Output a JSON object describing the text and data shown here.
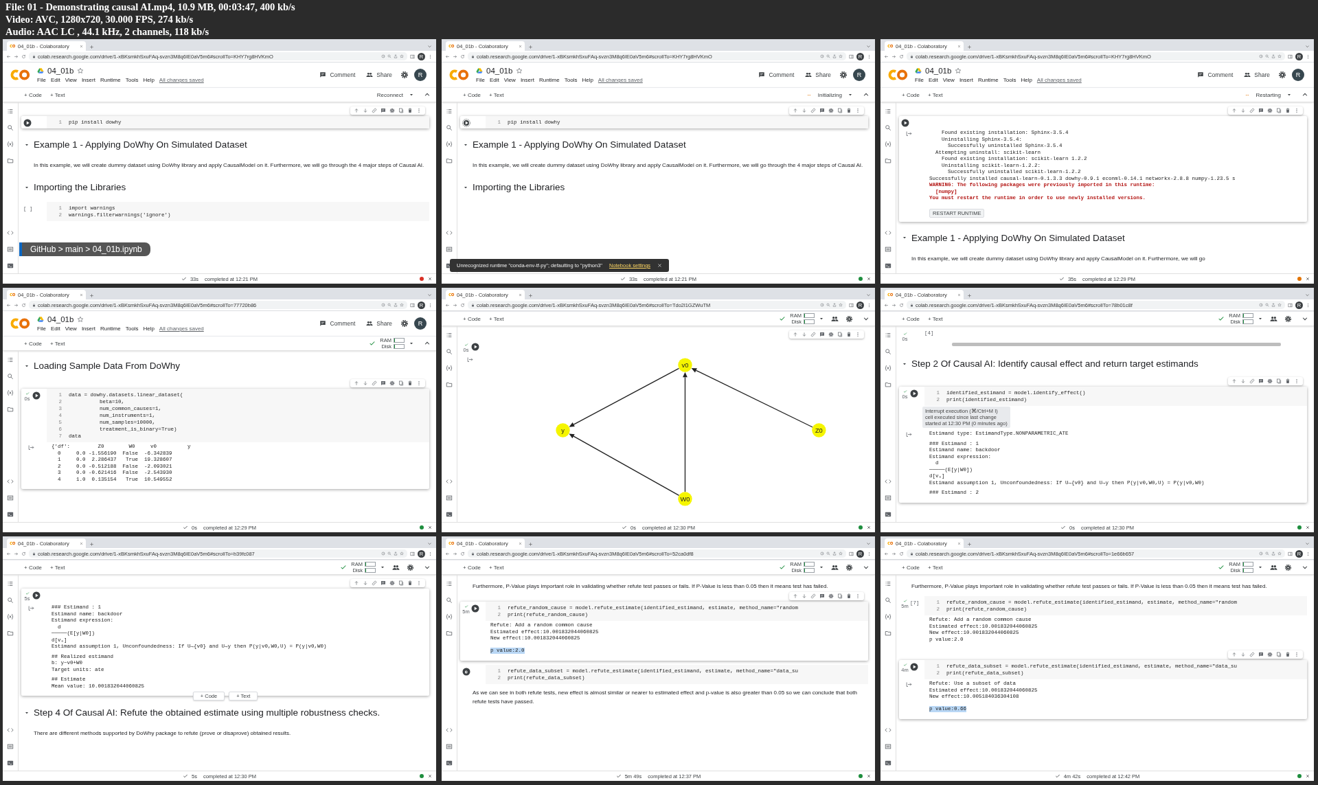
{
  "video_info": [
    "File: 01 - Demonstrating causal AI.mp4, 10.9 MB, 00:03:47, 400 kb/s",
    "Video: AVC, 1280x720, 30.000 FPS, 274 kb/s",
    "Audio: AAC LC , 44.1 kHz, 2 channels, 118 kb/s"
  ],
  "tiles": [
    {
      "browser": {
        "tab_title": "04_01b - Colaboratory",
        "url": "colab.research.google.com/drive/1-xBKsmkhSxuFAq-svzn3M8q6IE0aV5m6#scrollTo=KHY7rg8HVKmO",
        "profile": "R"
      },
      "notebook": {
        "name": "04_01b",
        "menu": [
          "File",
          "Edit",
          "View",
          "Insert",
          "Runtime",
          "Tools",
          "Help"
        ],
        "saved": "All changes saved",
        "comment": "Comment",
        "share": "Share",
        "avatar": "R"
      },
      "toolbar": {
        "add": [
          "+ Code",
          "+ Text"
        ],
        "runtime": {
          "kind": "button",
          "label": "Reconnect"
        }
      },
      "blocks": [
        {
          "kind": "code",
          "running": false,
          "pending": false,
          "focused": true,
          "toolbar": true,
          "lines": [
            [
              "1",
              "pip install dowhy"
            ]
          ]
        },
        {
          "kind": "heading",
          "text": "Example 1 - Applying DoWhy On Simulated Dataset"
        },
        {
          "kind": "text",
          "text": "In this example, we will create dummy dataset using DoWhy library and apply CausalModel on it. Furthermore, we will go through the 4 major steps of Causal AI."
        },
        {
          "kind": "heading",
          "text": "Importing the Libraries"
        },
        {
          "kind": "code",
          "prompt": "[ ]",
          "focused": false,
          "lines": [
            [
              "1",
              "import warnings"
            ],
            [
              "2",
              "warnings.filterwarnings('ignore')"
            ]
          ]
        }
      ],
      "overlay": {
        "kind": "banner",
        "text": "GitHub > main > 04_01b.ipynb"
      },
      "status": {
        "duration": "33s",
        "completed": "completed at 12:21 PM",
        "color": "#d93025"
      }
    },
    {
      "browser": {
        "tab_title": "04_01b - Colaboratory",
        "url": "colab.research.google.com/drive/1-xBKsmkhSxuFAq-svzn3M8q6IE0aV5m6#scrollTo=KHY7rg8HVKmO",
        "profile": "R"
      },
      "notebook": {
        "name": "04_01b",
        "menu": [
          "File",
          "Edit",
          "View",
          "Insert",
          "Runtime",
          "Tools",
          "Help"
        ],
        "saved": "All changes saved",
        "comment": "Comment",
        "share": "Share",
        "avatar": "R"
      },
      "toolbar": {
        "add": [
          "+ Code",
          "+ Text"
        ],
        "runtime": {
          "kind": "busy",
          "label": "Initializing"
        }
      },
      "blocks": [
        {
          "kind": "code",
          "running": true,
          "pending": false,
          "focused": true,
          "toolbar": true,
          "lines": [
            [
              "1",
              "pip install dowhy"
            ]
          ]
        },
        {
          "kind": "heading",
          "text": "Example 1 - Applying DoWhy On Simulated Dataset"
        },
        {
          "kind": "text",
          "text": "In this example, we will create dummy dataset using DoWhy library and apply CausalModel on it. Furthermore, we will go through the 4 major steps of Causal AI."
        },
        {
          "kind": "heading",
          "text": "Importing the Libraries"
        }
      ],
      "overlay": {
        "kind": "toast",
        "text": "Unrecognized runtime \"conda-env-tf-py\"; defaulting to \"python3\"",
        "link": "Notebook settings"
      },
      "status": {
        "duration": "33s",
        "completed": "completed at 12:21 PM",
        "color": "#1e8e3e"
      }
    },
    {
      "browser": {
        "tab_title": "04_01b - Colaboratory",
        "url": "colab.research.google.com/drive/1-xBKsmkhSxuFAq-svzn3M8q6IE0aV5m6#scrollTo=KHY7rg8HVKmO",
        "profile": "R"
      },
      "notebook": {
        "name": "04_01b",
        "menu": [
          "File",
          "Edit",
          "View",
          "Insert",
          "Runtime",
          "Tools",
          "Help"
        ],
        "saved": "All changes saved",
        "comment": "Comment",
        "share": "Share",
        "avatar": "R"
      },
      "toolbar": {
        "add": [
          "+ Code",
          "+ Text"
        ],
        "runtime": {
          "kind": "busy",
          "label": "Restarting"
        }
      },
      "blocks": [
        {
          "kind": "code",
          "running": false,
          "pending": false,
          "focused": true,
          "toolbar": true,
          "output": {
            "icon": true,
            "groups": [
              [
                "    Found existing installation: Sphinx-3.5.4",
                "    Uninstalling Sphinx-3.5.4:",
                "      Successfully uninstalled Sphinx-3.5.4",
                "  Attempting uninstall: scikit-learn",
                "    Found existing installation: scikit-learn 1.2.2",
                "    Uninstalling scikit-learn-1.2.2:",
                "      Successfully uninstalled scikit-learn-1.2.2",
                "Successfully installed causal-learn-0.1.3.3 dowhy-0.9.1 econml-0.14.1 networkx-2.8.8 numpy-1.23.5 s",
                {
                  "text": "WARNING: The following packages were previously imported in this runtime:",
                  "kind": "warning"
                },
                {
                  "text": "  [numpy]",
                  "kind": "warning"
                },
                {
                  "text": "You must restart the runtime in order to use newly installed versions.",
                  "kind": "warning"
                }
              ]
            ],
            "button": "RESTART RUNTIME"
          }
        },
        {
          "kind": "heading",
          "text": "Example 1 - Applying DoWhy On Simulated Dataset"
        },
        {
          "kind": "text",
          "text": "In this example, we will create dummy dataset using DoWhy library and apply CausalModel on it. Furthermore, we will go"
        }
      ],
      "status": {
        "duration": "35s",
        "completed": "completed at 12:29 PM",
        "color": "#e37400"
      }
    },
    {
      "browser": {
        "tab_title": "04_01b - Colaboratory",
        "url": "colab.research.google.com/drive/1-xBKsmkhSxuFAq-svzn3M8q6IE0aV5m6#scrollTo=77720b86",
        "profile": "R"
      },
      "notebook": {
        "name": "04_01b",
        "menu": [
          "File",
          "Edit",
          "View",
          "Insert",
          "Runtime",
          "Tools",
          "Help"
        ],
        "saved": "All changes saved",
        "comment": "Comment",
        "share": "Share",
        "avatar": "R"
      },
      "toolbar": {
        "add": [
          "+ Code",
          "+ Text"
        ],
        "runtime": {
          "kind": "resources",
          "meters": [
            {
              "label": "RAM",
              "level": 0.05
            },
            {
              "label": "Disk",
              "level": 0.05
            }
          ]
        }
      },
      "blocks": [
        {
          "kind": "heading",
          "text": "Loading Sample Data From DoWhy"
        },
        {
          "kind": "code",
          "running": false,
          "pending": false,
          "exec": "0s",
          "focused": true,
          "toolbar": true,
          "lines": [
            [
              "1",
              "data = dowhy.datasets.linear_dataset("
            ],
            [
              "2",
              "          beta=10,"
            ],
            [
              "3",
              "          num_common_causes=1,"
            ],
            [
              "4",
              "          num_instruments=1,"
            ],
            [
              "5",
              "          num_samples=10000,"
            ],
            [
              "6",
              "          treatment_is_binary=True)"
            ],
            [
              "7",
              "data"
            ]
          ],
          "output": {
            "icon": true,
            "groups": [
              [
                "{'df':         Z0        W0     v0          y",
                "  0     0.0 -1.556190  False  -6.342839",
                "  1     0.0  2.286437   True  19.328607",
                "  2     0.0 -0.512188  False  -2.093021",
                "  3     0.0 -0.621416  False  -2.543930",
                "  4     1.0  0.135154   True  10.549552"
              ]
            ]
          }
        }
      ],
      "status": {
        "duration": "0s",
        "completed": "completed at 12:29 PM",
        "color": "#1e8e3e"
      }
    },
    {
      "browser": {
        "tab_title": "04_01b - Colaboratory",
        "url": "colab.research.google.com/drive/1-xBKsmkhSxuFAq-svzn3M8q6IE0aV5m6#scrollTo=Tdo2l1GZWuTM",
        "profile": "R"
      },
      "toolbar": {
        "add": [
          "+ Code",
          "+ Text"
        ],
        "runtime": {
          "kind": "resources",
          "meters": [
            {
              "label": "RAM",
              "level": 0.05
            },
            {
              "label": "Disk",
              "level": 0.05
            }
          ]
        }
      },
      "blocks": [
        {
          "kind": "code",
          "running": false,
          "pending": false,
          "exec": "0s",
          "focused": false,
          "toolbar": true,
          "output": {
            "icon": true,
            "graph": {
              "nodes": [
                {
                  "label": "v0"
                },
                {
                  "label": "y"
                },
                {
                  "label": "Z0"
                },
                {
                  "label": "W0"
                }
              ]
            }
          }
        }
      ],
      "status": {
        "duration": "0s",
        "completed": "completed at 12:30 PM",
        "color": "#1e8e3e"
      }
    },
    {
      "browser": {
        "tab_title": "04_01b - Colaboratory",
        "url": "colab.research.google.com/drive/1-xBKsmkhSxuFAq-svzn3M8q6IE0aV5m6#scrollTo=78b01c8f",
        "profile": "R"
      },
      "toolbar": {
        "add": [
          "+ Code",
          "+ Text"
        ],
        "runtime": {
          "kind": "resources",
          "meters": [
            {
              "label": "RAM",
              "level": 0.05
            },
            {
              "label": "Disk",
              "level": 0.05
            }
          ]
        }
      },
      "blocks": [
        {
          "kind": "cell_tail",
          "prompt": "[4]",
          "exec": "0s"
        },
        {
          "kind": "heading",
          "text": "Step 2 Of Causal AI: Identify causal effect and return target estimands"
        },
        {
          "kind": "code",
          "running": false,
          "pending": false,
          "exec": "0s",
          "focused": true,
          "toolbar": true,
          "lines": [
            [
              "1",
              "identified_estimand = model.identify_effect()"
            ],
            [
              "2",
              "print(identified_estimand)"
            ]
          ],
          "tooltip": [
            "Interrupt execution (⌘/Ctrl+M I)",
            "cell executed since last change",
            "started at 12:30 PM (0 minutes ago)"
          ],
          "output": {
            "icon": true,
            "groups": [
              [
                "Estimand type: EstimandType.NONPARAMETRIC_ATE"
              ],
              [
                "### Estimand : 1",
                "Estimand name: backdoor",
                "Estimand expression:",
                "  d",
                "─────(E[y|W0])",
                "d[v₀]",
                "Estimand assumption 1, Unconfoundedness: If U→{v0} and U→y then P(y|v0,W0,U) = P(y|v0,W0)"
              ],
              [
                "### Estimand : 2"
              ]
            ]
          }
        }
      ],
      "status": {
        "duration": "0s",
        "completed": "completed at 12:30 PM",
        "color": "#1e8e3e"
      }
    },
    {
      "browser": {
        "tab_title": "04_01b - Colaboratory",
        "url": "colab.research.google.com/drive/1-xBKsmkhSxuFAq-svzn3M8q6IE0aV5m6#scrollTo=b39fc087",
        "profile": "R"
      },
      "toolbar": {
        "add": [
          "+ Code",
          "+ Text"
        ],
        "runtime": {
          "kind": "resources",
          "meters": [
            {
              "label": "RAM",
              "level": 0.05
            },
            {
              "label": "Disk",
              "level": 0.05
            }
          ]
        }
      },
      "blocks": [
        {
          "kind": "code",
          "running": false,
          "pending": false,
          "exec": "5s",
          "focused": true,
          "toolbar": true,
          "output": {
            "icon": true,
            "groups": [
              [
                "### Estimand : 1",
                "Estimand name: backdoor",
                "Estimand expression:",
                "  d",
                "─────(E[y|W0])",
                "d[v₀]",
                "Estimand assumption 1, Unconfoundedness: If U→{v0} and U→y then P(y|v0,W0,U) = P(y|v0,W0)"
              ],
              [
                "## Realized estimand",
                "b: y~v0+W0",
                "Target units: ate"
              ],
              [
                "## Estimate",
                "Mean value: 10.001832044060825"
              ]
            ]
          }
        },
        {
          "kind": "add_cell",
          "buttons": [
            "+ Code",
            "+ Text"
          ]
        },
        {
          "kind": "heading",
          "text": "Step 4 Of Causal AI: Refute the obtained estimate using multiple robustness checks."
        },
        {
          "kind": "text",
          "text": "There are different methods supported by DoWhy package to refute (prove or disaprove) obtained results."
        }
      ],
      "status": {
        "duration": "5s",
        "completed": "completed at 12:30 PM",
        "color": "#1e8e3e"
      }
    },
    {
      "browser": {
        "tab_title": "04_01b - Colaboratory",
        "url": "colab.research.google.com/drive/1-xBKsmkhSxuFAq-svzn3M8q6IE0aV5m6#scrollTo=52ca0df8",
        "profile": "R"
      },
      "toolbar": {
        "add": [
          "+ Code",
          "+ Text"
        ],
        "runtime": {
          "kind": "resources",
          "meters": [
            {
              "label": "RAM",
              "level": 0.05
            },
            {
              "label": "Disk",
              "level": 0.05
            }
          ]
        }
      },
      "blocks": [
        {
          "kind": "text",
          "text": "Furthermore, P-Value plays important role in validating whether refute test passes or fails. If P-Value is less than 0.05 then it means test has failed."
        },
        {
          "kind": "code",
          "running": false,
          "pending": false,
          "exec": "5m",
          "focused": true,
          "toolbar": true,
          "lines": [
            [
              "1",
              "refute_random_cause = model.refute_estimate(identified_estimand, estimate, method_name=\"random"
            ],
            [
              "2",
              "print(refute_random_cause)"
            ]
          ],
          "output": {
            "groups": [
              [
                "Refute: Add a random common cause",
                "Estimated effect:10.001832044060825",
                "New effect:10.001832044060825",
                {
                  "text": "p value:2.0",
                  "kind": "highlight"
                }
              ]
            ]
          }
        },
        {
          "kind": "code",
          "running": false,
          "pending": true,
          "focused": false,
          "lines": [
            [
              "1",
              "refute_data_subset = model.refute_estimate(identified_estimand, estimate, method_name=\"data_su"
            ],
            [
              "2",
              "print(refute_data_subset)"
            ]
          ]
        },
        {
          "kind": "text",
          "text": "As we can see in both refute tests, new effect is almost similar or nearer to estimated effect and p-value is also greater than 0.05 so we can conclude that both refute tests have passed."
        }
      ],
      "status": {
        "duration": "5m 49s",
        "completed": "completed at 12:37 PM",
        "color": "#1e8e3e"
      }
    },
    {
      "browser": {
        "tab_title": "04_01b - Colaboratory",
        "url": "colab.research.google.com/drive/1-xBKsmkhSxuFAq-svzn3M8q6IE0aV5m6#scrollTo=1e66b657",
        "profile": "R"
      },
      "toolbar": {
        "add": [
          "+ Code",
          "+ Text"
        ],
        "runtime": {
          "kind": "resources",
          "meters": [
            {
              "label": "RAM",
              "level": 0.05
            },
            {
              "label": "Disk",
              "level": 0.05
            }
          ]
        }
      },
      "blocks": [
        {
          "kind": "text",
          "text": "Furthermore, P-Value plays important role in validating whether refute test passes or fails. If P-Value is less than 0.05 then it means test has failed."
        },
        {
          "kind": "code",
          "prompt": "[7]",
          "exec": "5m",
          "focused": false,
          "lines": [
            [
              "1",
              "refute_random_cause = model.refute_estimate(identified_estimand, estimate, method_name=\"random"
            ],
            [
              "2",
              "print(refute_random_cause)"
            ]
          ],
          "output": {
            "groups": [
              [
                "Refute: Add a random common cause",
                "Estimated effect:10.001832044060825",
                "New effect:10.001832044060825",
                "p value:2.0"
              ]
            ]
          }
        },
        {
          "kind": "code",
          "running": false,
          "pending": false,
          "exec": "4m",
          "focused": true,
          "toolbar": true,
          "lines": [
            [
              "1",
              "refute_data_subset = model.refute_estimate(identified_estimand, estimate, method_name=\"data_su"
            ],
            [
              "2",
              "print(refute_data_subset)"
            ]
          ],
          "output": {
            "icon": true,
            "groups": [
              [
                "Refute: Use a subset of data",
                "Estimated effect:10.001832044060825",
                "New effect:10.005184036304108",
                {
                  "text": "p value:0.66",
                  "kind": "highlight"
                }
              ]
            ]
          }
        }
      ],
      "status": {
        "duration": "4m 42s",
        "completed": "completed at 12:42 PM",
        "color": "#1e8e3e"
      }
    }
  ]
}
